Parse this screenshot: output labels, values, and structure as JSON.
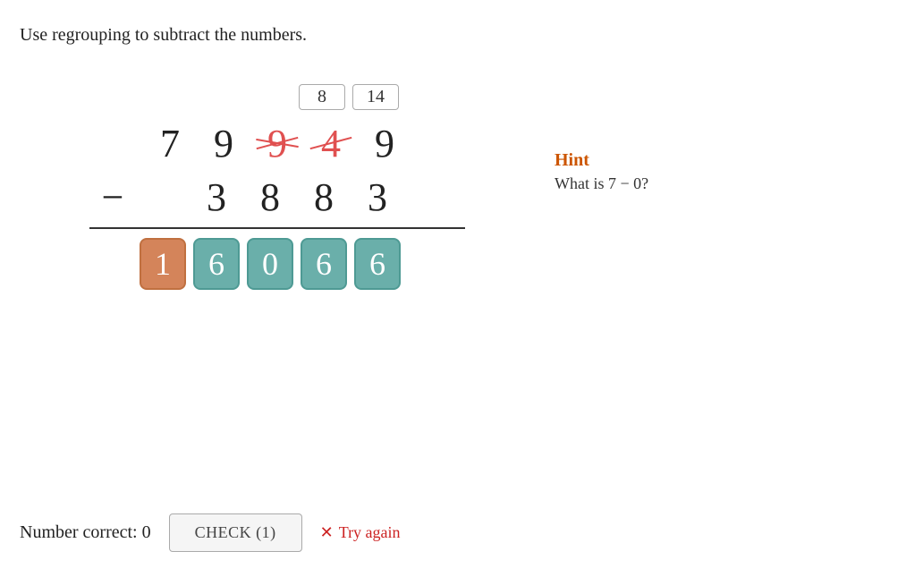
{
  "instruction": "Use regrouping to subtract the numbers.",
  "regroup": {
    "row": [
      {
        "value": "8",
        "show": true
      },
      {
        "value": "14",
        "show": true
      }
    ]
  },
  "top_number": {
    "digits": [
      "7",
      "9",
      "9",
      "4",
      "9"
    ],
    "crossed": [
      false,
      false,
      true,
      true,
      false
    ]
  },
  "bottom_number": {
    "digits": [
      "3",
      "8",
      "8",
      "3"
    ]
  },
  "answer": {
    "digits": [
      "1",
      "6",
      "0",
      "6",
      "6"
    ],
    "types": [
      "orange",
      "teal",
      "teal",
      "teal",
      "teal"
    ]
  },
  "hint": {
    "title": "Hint",
    "text": "What is 7 − 0?"
  },
  "bottom": {
    "number_correct_label": "Number correct: 0",
    "check_button": "CHECK (1)",
    "try_again_label": "Try again"
  }
}
